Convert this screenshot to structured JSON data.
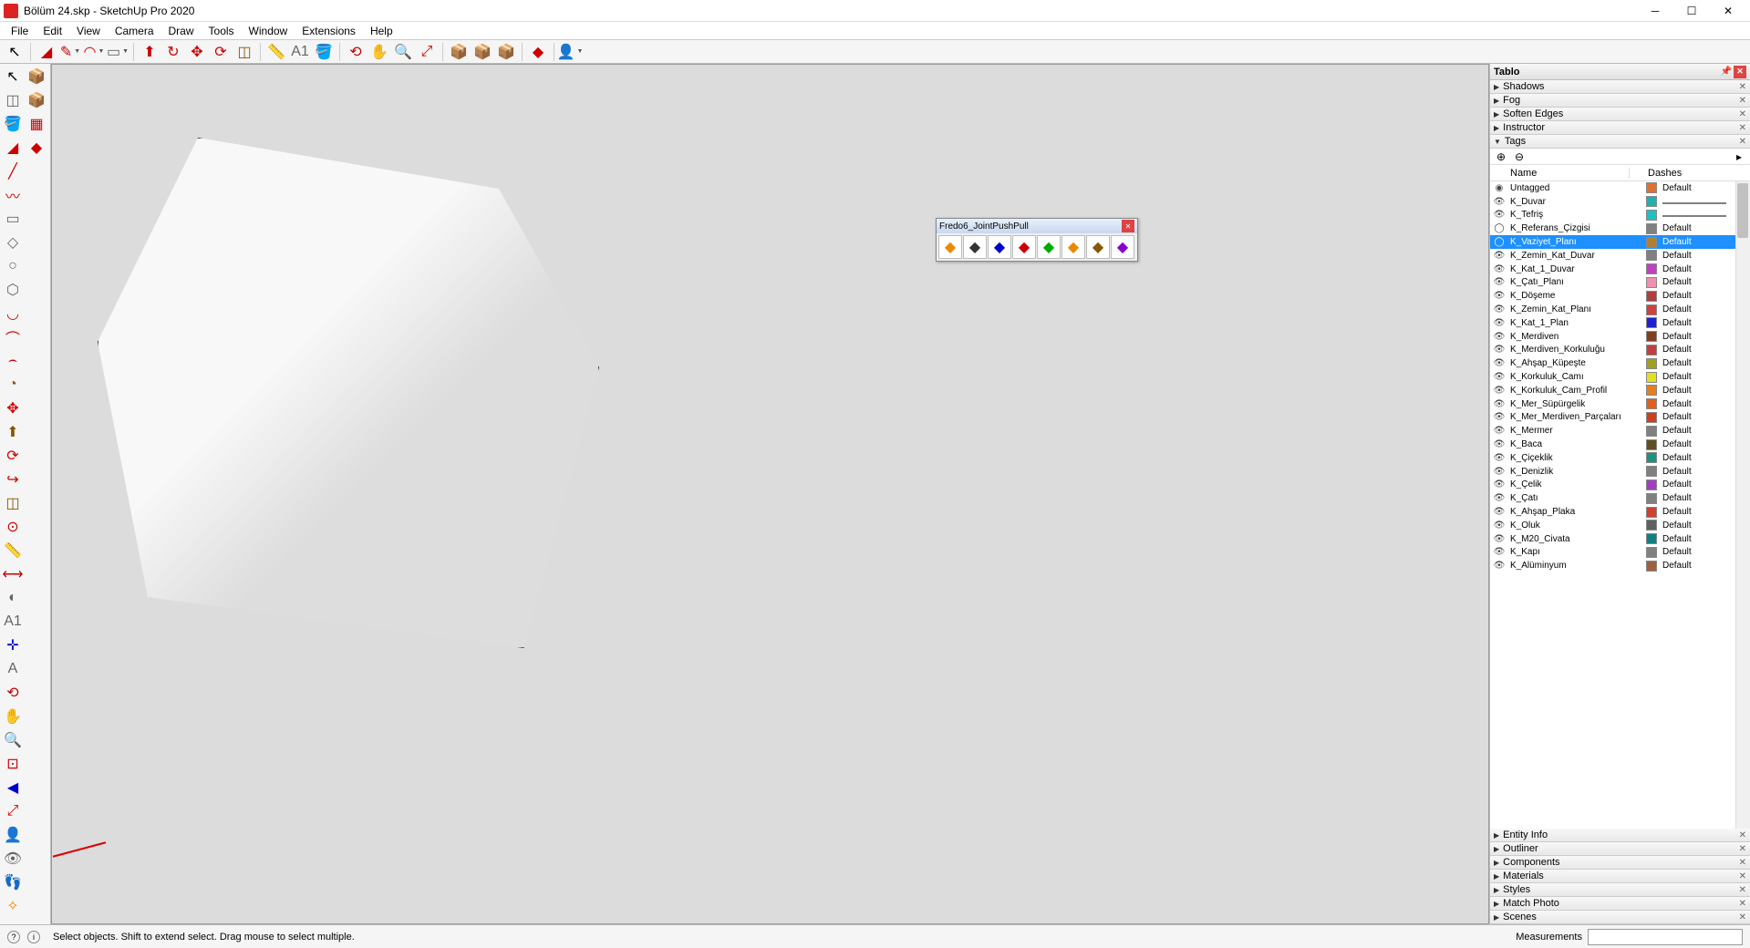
{
  "app": {
    "title": "Bölüm 24.skp - SketchUp Pro 2020"
  },
  "menu": [
    "File",
    "Edit",
    "View",
    "Camera",
    "Draw",
    "Tools",
    "Window",
    "Extensions",
    "Help"
  ],
  "fredo": {
    "title": "Fredo6_JointPushPull"
  },
  "panel": {
    "title": "Tablo",
    "sections_top": [
      "Shadows",
      "Fog",
      "Soften Edges",
      "Instructor"
    ],
    "tags_label": "Tags",
    "sections_bottom": [
      "Entity Info",
      "Outliner",
      "Components",
      "Materials",
      "Styles",
      "Match Photo",
      "Scenes"
    ],
    "cols": {
      "name": "Name",
      "dashes": "Dashes"
    }
  },
  "tags": [
    {
      "vis": "eye",
      "name": "Untagged",
      "color": "#e07030",
      "dash": "Default",
      "selected": false,
      "vis_icon": "dot"
    },
    {
      "vis": "eye",
      "name": "K_Duvar",
      "color": "#20b0b0",
      "dash": "line",
      "selected": false
    },
    {
      "vis": "eye",
      "name": "K_Tefriş",
      "color": "#20c0c0",
      "dash": "line",
      "selected": false
    },
    {
      "vis": "open",
      "name": "K_Referans_Çizgisi",
      "color": "#808080",
      "dash": "Default",
      "selected": false
    },
    {
      "vis": "open",
      "name": "K_Vaziyet_Planı",
      "color": "#b08030",
      "dash": "Default",
      "selected": true
    },
    {
      "vis": "eye",
      "name": "K_Zemin_Kat_Duvar",
      "color": "#808080",
      "dash": "Default",
      "selected": false
    },
    {
      "vis": "eye",
      "name": "K_Kat_1_Duvar",
      "color": "#c040c0",
      "dash": "Default",
      "selected": false
    },
    {
      "vis": "eye",
      "name": "K_Çatı_Planı",
      "color": "#f090b0",
      "dash": "Default",
      "selected": false
    },
    {
      "vis": "eye",
      "name": "K_Döşeme",
      "color": "#b04040",
      "dash": "Default",
      "selected": false
    },
    {
      "vis": "eye",
      "name": "K_Zemin_Kat_Planı",
      "color": "#d04040",
      "dash": "Default",
      "selected": false
    },
    {
      "vis": "eye",
      "name": "K_Kat_1_Plan",
      "color": "#2020d0",
      "dash": "Default",
      "selected": false
    },
    {
      "vis": "eye",
      "name": "K_Merdiven",
      "color": "#804020",
      "dash": "Default",
      "selected": false
    },
    {
      "vis": "eye",
      "name": "K_Merdiven_Korkuluğu",
      "color": "#c04040",
      "dash": "Default",
      "selected": false
    },
    {
      "vis": "eye",
      "name": "K_Ahşap_Küpeşte",
      "color": "#a0a020",
      "dash": "Default",
      "selected": false
    },
    {
      "vis": "eye",
      "name": "K_Korkuluk_Camı",
      "color": "#e0e020",
      "dash": "Default",
      "selected": false
    },
    {
      "vis": "eye",
      "name": "K_Korkuluk_Cam_Profil",
      "color": "#e08020",
      "dash": "Default",
      "selected": false
    },
    {
      "vis": "eye",
      "name": "K_Mer_Süpürgelik",
      "color": "#e06020",
      "dash": "Default",
      "selected": false
    },
    {
      "vis": "eye",
      "name": "K_Mer_Merdiven_Parçaları",
      "color": "#d04020",
      "dash": "Default",
      "selected": false
    },
    {
      "vis": "eye",
      "name": "K_Mermer",
      "color": "#808080",
      "dash": "Default",
      "selected": false
    },
    {
      "vis": "eye",
      "name": "K_Baca",
      "color": "#605020",
      "dash": "Default",
      "selected": false
    },
    {
      "vis": "eye",
      "name": "K_Çiçeklik",
      "color": "#209080",
      "dash": "Default",
      "selected": false
    },
    {
      "vis": "eye",
      "name": "K_Denizlik",
      "color": "#808080",
      "dash": "Default",
      "selected": false
    },
    {
      "vis": "eye",
      "name": "K_Çelik",
      "color": "#a040c0",
      "dash": "Default",
      "selected": false
    },
    {
      "vis": "eye",
      "name": "K_Çatı",
      "color": "#808080",
      "dash": "Default",
      "selected": false
    },
    {
      "vis": "eye",
      "name": "K_Ahşap_Plaka",
      "color": "#d04030",
      "dash": "Default",
      "selected": false
    },
    {
      "vis": "eye",
      "name": "K_Oluk",
      "color": "#606060",
      "dash": "Default",
      "selected": false
    },
    {
      "vis": "eye",
      "name": "K_M20_Civata",
      "color": "#108080",
      "dash": "Default",
      "selected": false
    },
    {
      "vis": "eye",
      "name": "K_Kapı",
      "color": "#808080",
      "dash": "Default",
      "selected": false
    },
    {
      "vis": "eye",
      "name": "K_Alüminyum",
      "color": "#a06040",
      "dash": "Default",
      "selected": false
    }
  ],
  "status": {
    "hint": "Select objects. Shift to extend select. Drag mouse to select multiple.",
    "meas_label": "Measurements"
  }
}
